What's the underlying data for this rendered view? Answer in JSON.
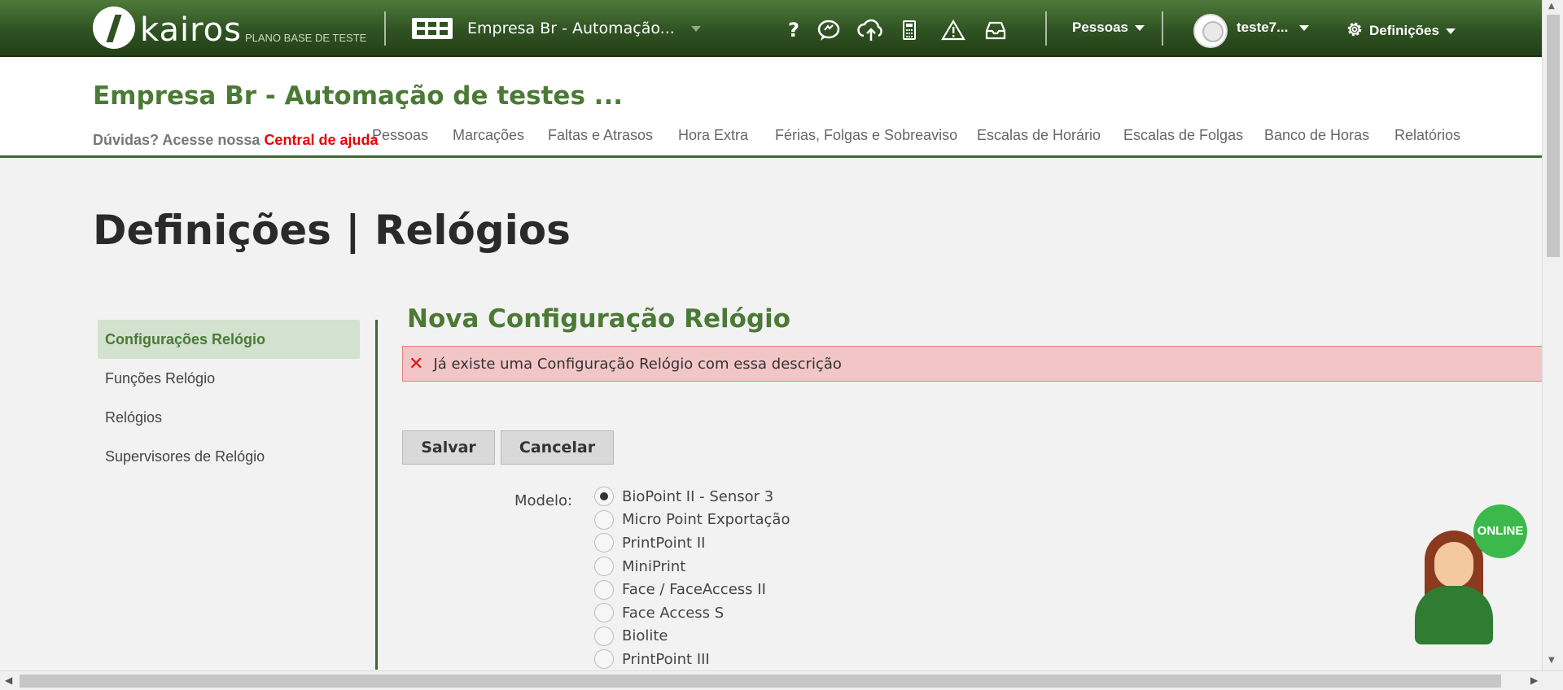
{
  "topbar": {
    "logo_text": "kairos",
    "logo_sub": "PLANO BASE DE TESTE",
    "company_selector": "Empresa Br - Automação...",
    "icons": [
      "help-icon",
      "chat-support-icon",
      "cloud-upload-icon",
      "calculator-icon",
      "warning-icon",
      "inbox-icon"
    ],
    "help_glyph": "?",
    "pessoas_menu": "Pessoas",
    "user_menu": "teste7...",
    "settings_menu": "Definições"
  },
  "header": {
    "company_title": "Empresa Br - Automação de testes ...",
    "help_prefix": "Dúvidas? Acesse nossa ",
    "help_link": "Central de ajuda",
    "nav": [
      "Pessoas",
      "Marcações",
      "Faltas e Atrasos",
      "Hora Extra",
      "Férias, Folgas e Sobreaviso",
      "Escalas de Horário",
      "Escalas de Folgas",
      "Banco de Horas",
      "Relatórios"
    ]
  },
  "page": {
    "title": "Definições | Relógios",
    "sidebar": [
      "Configurações Relógio",
      "Funções Relógio",
      "Relógios",
      "Supervisores de Relógio"
    ],
    "active_sidebar": "Configurações Relógio",
    "section_title": "Nova Configuração Relógio",
    "error_message": "Já existe uma Configuração Relógio com essa descrição",
    "save_button": "Salvar",
    "cancel_button": "Cancelar",
    "model_label": "Modelo:",
    "models": [
      "BioPoint II - Sensor 3",
      "Micro Point Exportação",
      "PrintPoint II",
      "MiniPrint",
      "Face / FaceAccess II",
      "Face Access S",
      "Biolite",
      "PrintPoint III"
    ],
    "selected_model": "BioPoint II - Sensor 3"
  },
  "chat_widget": {
    "badge": "ONLINE"
  },
  "colors": {
    "brand_green": "#3d6a2e",
    "title_green": "#4a7a35",
    "error_bg": "#f2c6c6",
    "link_red": "#e00000"
  }
}
